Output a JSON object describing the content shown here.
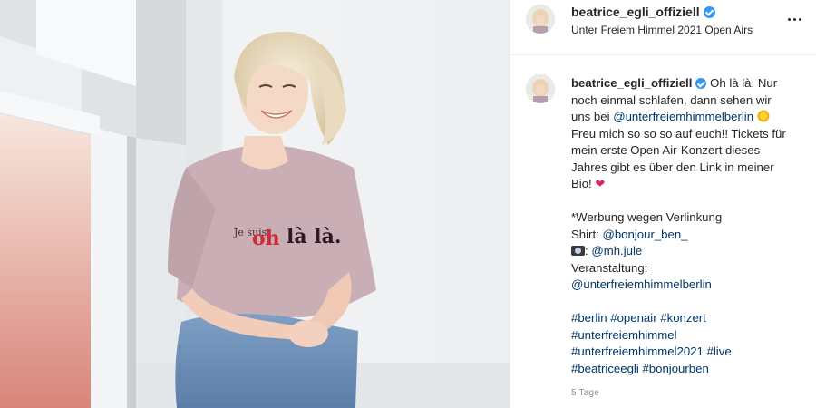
{
  "header": {
    "username": "beatrice_egli_offiziell",
    "location": "Unter Freiem Himmel 2021 Open Airs",
    "more_icon": "more-horizontal-icon"
  },
  "photo": {
    "shirt_line1": "Je suis",
    "shirt_line2_red": "oh",
    "shirt_line2_dark": "là là."
  },
  "caption": {
    "username": "beatrice_egli_offiziell",
    "text_1": "Oh là là. Nur noch einmal schlafen, dann sehen wir uns bei",
    "mention_festival": "@unterfreiemhimmelberlin",
    "text_2": "Freu mich so so so auf euch!! Tickets für mein erste Open Air-Konzert dieses Jahres gibt es über den Link in meiner Bio!",
    "credits_title": "*Werbung wegen Verlinkung",
    "shirt_label": "Shirt:",
    "mention_shirt": "@bonjour_ben_",
    "mention_photo": "@mh.jule",
    "event_label": "Veranstaltung:",
    "mention_event": "@unterfreiemhimmelberlin",
    "hashtags": [
      "#berlin",
      "#openair",
      "#konzert",
      "#unterfreiemhimmel",
      "#unterfreiemhimmel2021",
      "#live",
      "#beatriceegli",
      "#bonjourben"
    ]
  },
  "timestamp": "5 Tage",
  "colors": {
    "link": "#00376b",
    "verified": "#3897f0",
    "muted": "#8e8e8e"
  }
}
